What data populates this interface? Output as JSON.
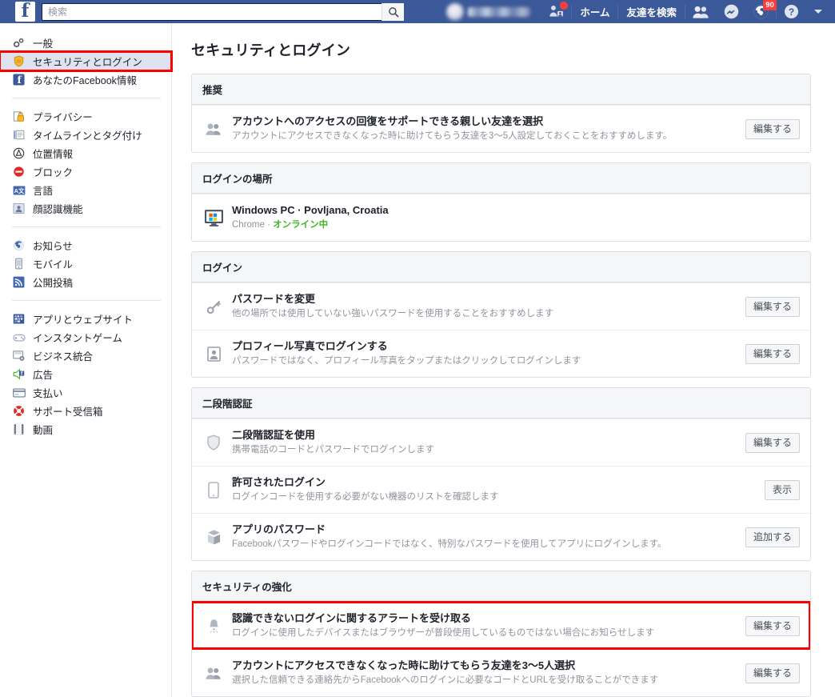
{
  "topbar": {
    "logo_letter": "f",
    "search": {
      "value": "",
      "placeholder": "検索"
    },
    "search_icon": "search-icon",
    "home_label": "ホーム",
    "find_friends_label": "友達を検索",
    "notifications_count": "90",
    "help_label": "?",
    "friend_requests_has_badge": true
  },
  "sidebar": {
    "groups": [
      {
        "items": [
          {
            "label": "一般",
            "icon": "gears-icon",
            "selected": false
          },
          {
            "label": "セキュリティとログイン",
            "icon": "shield-icon",
            "selected": true
          },
          {
            "label": "あなたのFacebook情報",
            "icon": "facebook-icon",
            "selected": false
          }
        ]
      },
      {
        "items": [
          {
            "label": "プライバシー",
            "icon": "lock-icon",
            "selected": false
          },
          {
            "label": "タイムラインとタグ付け",
            "icon": "timeline-icon",
            "selected": false
          },
          {
            "label": "位置情報",
            "icon": "location-icon",
            "selected": false
          },
          {
            "label": "ブロック",
            "icon": "block-icon",
            "selected": false
          },
          {
            "label": "言語",
            "icon": "language-icon",
            "selected": false
          },
          {
            "label": "顔認識機能",
            "icon": "face-recognition-icon",
            "selected": false
          }
        ]
      },
      {
        "items": [
          {
            "label": "お知らせ",
            "icon": "globe-icon",
            "selected": false
          },
          {
            "label": "モバイル",
            "icon": "mobile-icon",
            "selected": false
          },
          {
            "label": "公開投稿",
            "icon": "rss-icon",
            "selected": false
          }
        ]
      },
      {
        "items": [
          {
            "label": "アプリとウェブサイト",
            "icon": "apps-icon",
            "selected": false
          },
          {
            "label": "インスタントゲーム",
            "icon": "gamepad-icon",
            "selected": false
          },
          {
            "label": "ビジネス統合",
            "icon": "business-icon",
            "selected": false
          },
          {
            "label": "広告",
            "icon": "ads-icon",
            "selected": false
          },
          {
            "label": "支払い",
            "icon": "payments-icon",
            "selected": false
          },
          {
            "label": "サポート受信箱",
            "icon": "lifebuoy-icon",
            "selected": false
          },
          {
            "label": "動画",
            "icon": "video-icon",
            "selected": false
          }
        ]
      }
    ]
  },
  "main": {
    "title": "セキュリティとログイン",
    "sections": [
      {
        "heading": "推奨",
        "rows": [
          {
            "icon": "friends-icon",
            "title": "アカウントへのアクセスの回復をサポートできる親しい友達を選択",
            "sub": "アカウントにアクセスできなくなった時に助けてもらう友達を3〜5人設定しておくことをおすすめします。",
            "button": "編集する",
            "highlighted": false
          }
        ]
      },
      {
        "heading": "ログインの場所",
        "rows": [
          {
            "icon": "windows-pc-icon",
            "title": "Windows PC · Povljana, Croatia",
            "sub_browser": "Chrome",
            "sub_separator": " · ",
            "sub_status": "オンライン中",
            "button": "",
            "highlighted": false
          }
        ]
      },
      {
        "heading": "ログイン",
        "rows": [
          {
            "icon": "key-icon",
            "title": "パスワードを変更",
            "sub": "他の場所では使用していない強いパスワードを使用することをおすすめします",
            "button": "編集する",
            "highlighted": false
          },
          {
            "icon": "profile-photo-icon",
            "title": "プロフィール写真でログインする",
            "sub": "パスワードではなく、プロフィール写真をタップまたはクリックしてログインします",
            "button": "編集する",
            "highlighted": false
          }
        ]
      },
      {
        "heading": "二段階認証",
        "rows": [
          {
            "icon": "shield-outline-icon",
            "title": "二段階認証を使用",
            "sub": "携帯電話のコードとパスワードでログインします",
            "button": "編集する",
            "highlighted": false
          },
          {
            "icon": "phone-icon",
            "title": "許可されたログイン",
            "sub": "ログインコードを使用する必要がない機器のリストを確認します",
            "button": "表示",
            "highlighted": false
          },
          {
            "icon": "app-password-icon",
            "title": "アプリのパスワード",
            "sub": "Facebookパスワードやログインコードではなく、特別なパスワードを使用してアプリにログインします。",
            "button": "追加する",
            "highlighted": false
          }
        ]
      },
      {
        "heading": "セキュリティの強化",
        "rows": [
          {
            "icon": "bell-icon",
            "title": "認識できないログインに関するアラートを受け取る",
            "sub": "ログインに使用したデバイスまたはブラウザーが普段使用しているものではない場合にお知らせします",
            "button": "編集する",
            "highlighted": true
          },
          {
            "icon": "friends-icon",
            "title": "アカウントにアクセスできなくなった時に助けてもらう友達を3〜5人選択",
            "sub": "選択した信頼できる連絡先からFacebookへのログインに必要なコードとURLを受け取ることができます",
            "button": "編集する",
            "highlighted": false
          }
        ]
      }
    ]
  },
  "colors": {
    "brand_blue": "#3b5998",
    "highlight_red": "#ff0000",
    "online_green": "#42b72a",
    "selected_bg": "#dfe3ee"
  }
}
